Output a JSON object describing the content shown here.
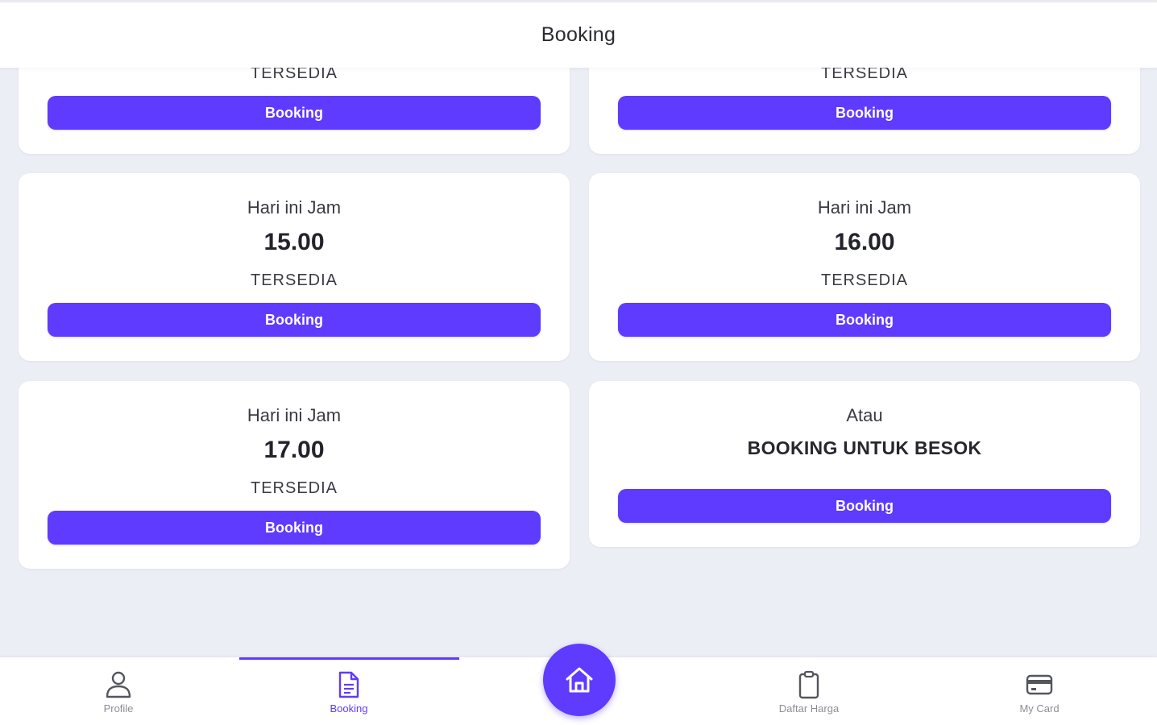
{
  "header": {
    "title": "Booking"
  },
  "slots": [
    {
      "status": "TERSEDIA",
      "button": "Booking"
    },
    {
      "status": "TERSEDIA",
      "button": "Booking"
    },
    {
      "line1": "Hari ini Jam",
      "time": "15.00",
      "status": "TERSEDIA",
      "button": "Booking"
    },
    {
      "line1": "Hari ini Jam",
      "time": "16.00",
      "status": "TERSEDIA",
      "button": "Booking"
    },
    {
      "line1": "Hari ini Jam",
      "time": "17.00",
      "status": "TERSEDIA",
      "button": "Booking"
    }
  ],
  "tomorrow": {
    "line1": "Atau",
    "title": "BOOKING UNTUK BESOK",
    "button": "Booking"
  },
  "nav": {
    "items": [
      {
        "label": "Profile",
        "icon": "user-icon"
      },
      {
        "label": "Booking",
        "icon": "document-icon",
        "active": true
      },
      {
        "label": "Daftar Harga",
        "icon": "clipboard-icon"
      },
      {
        "label": "My Card",
        "icon": "credit-card-icon"
      }
    ],
    "home_icon": "home-icon"
  },
  "colors": {
    "accent": "#5f3bff",
    "background": "#eceef6",
    "card": "#ffffff"
  }
}
